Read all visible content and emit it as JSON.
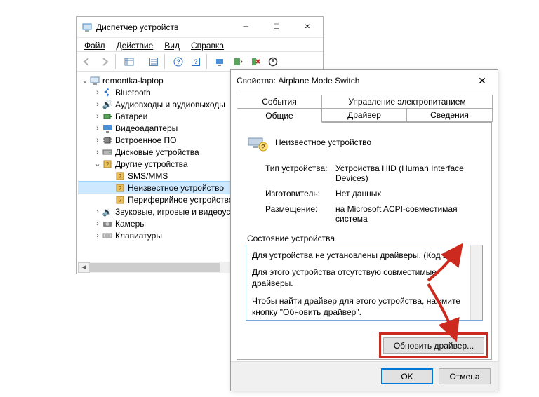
{
  "device_manager": {
    "title": "Диспетчер устройств",
    "menus": {
      "file": "Файл",
      "action": "Действие",
      "view": "Вид",
      "help": "Справка"
    },
    "tree": {
      "root": "remontka-laptop",
      "items": [
        {
          "label": "Bluetooth"
        },
        {
          "label": "Аудиовходы и аудиовыходы"
        },
        {
          "label": "Батареи"
        },
        {
          "label": "Видеоадаптеры"
        },
        {
          "label": "Встроенное ПО"
        },
        {
          "label": "Дисковые устройства"
        },
        {
          "label": "Другие устройства",
          "expanded": true,
          "children": [
            {
              "label": "SMS/MMS"
            },
            {
              "label": "Неизвестное устройство",
              "selected": true
            },
            {
              "label": "Периферийное устройство"
            }
          ]
        },
        {
          "label": "Звуковые, игровые и видеоуст"
        },
        {
          "label": "Камеры"
        },
        {
          "label": "Клавиатуры"
        }
      ]
    }
  },
  "properties": {
    "title": "Свойства: Airplane Mode Switch",
    "tabs": {
      "events": "События",
      "power": "Управление электропитанием",
      "general": "Общие",
      "driver": "Драйвер",
      "details": "Сведения"
    },
    "device_name": "Неизвестное устройство",
    "rows": {
      "type_label": "Тип устройства:",
      "type_value": "Устройства HID (Human Interface Devices)",
      "mfg_label": "Изготовитель:",
      "mfg_value": "Нет данных",
      "loc_label": "Размещение:",
      "loc_value": "на Microsoft ACPI-совместимая система"
    },
    "status_label": "Состояние устройства",
    "status_lines": {
      "l1": "Для устройства не установлены драйверы. (Код 28)",
      "l2": "Для этого устройства отсутствую совместимые драйверы.",
      "l3": "Чтобы найти драйвер для этого устройства, нажмите кнопку \"Обновить драйвер\"."
    },
    "update_btn": "Обновить драйвер...",
    "ok": "OK",
    "cancel": "Отмена"
  }
}
